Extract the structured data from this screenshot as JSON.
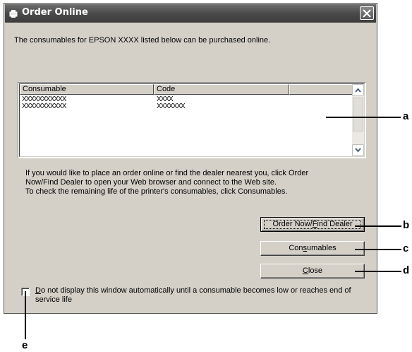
{
  "window": {
    "title": "Order Online",
    "intro_text": "The consumables for EPSON XXXX listed below can be purchased online."
  },
  "list": {
    "columns": [
      "Consumable",
      "Code",
      ""
    ],
    "rows": [
      {
        "consumable": "XXXXXXXXXXX",
        "code": "XXXX"
      },
      {
        "consumable": "XXXXXXXXXXX",
        "code": "XXXXXXX"
      }
    ]
  },
  "description": {
    "line1": "If you would like to place an order online or find the dealer nearest you, click Order",
    "line2": "Now/Find Dealer to open your Web browser and connect to the Web site.",
    "line3": "To check the remaining life of the printer's consumables, click Consumables."
  },
  "buttons": {
    "order_now_pre": "Order Now/",
    "order_now_acc": "F",
    "order_now_post": "ind Dealer",
    "consumables_pre": "Con",
    "consumables_acc": "s",
    "consumables_post": "umables",
    "close_acc": "C",
    "close_post": "lose"
  },
  "checkbox": {
    "checked": false,
    "label_acc": "D",
    "label_rest": "o not display this window automatically until a consumable becomes low or reaches end of service life"
  },
  "callouts": {
    "a": "a",
    "b": "b",
    "c": "c",
    "d": "d",
    "e": "e"
  }
}
